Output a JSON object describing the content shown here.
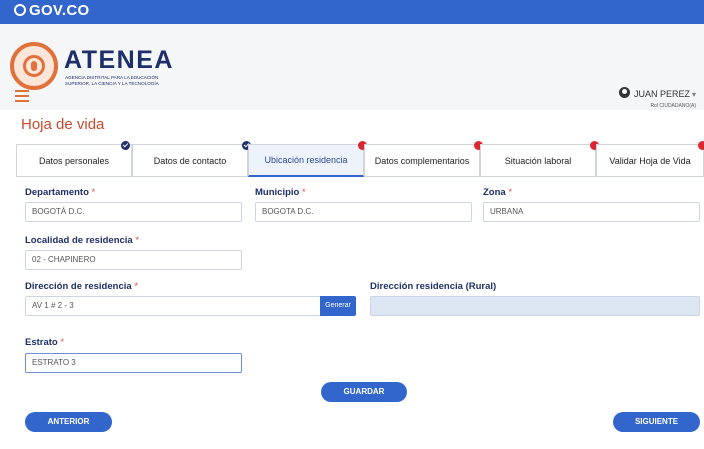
{
  "gov_bar": {
    "label": "GOV.CO",
    "icon": "gov-shield-icon"
  },
  "brand": {
    "name": "ATENEA",
    "subtitle": "AGENCIA DISTRITAL PARA LA EDUCACIÓN SUPERIOR, LA CIENCIA Y LA TECNOLOGÍA",
    "accent": "#e0713a",
    "primary": "#1e2f6b"
  },
  "user": {
    "name": "JUAN PEREZ",
    "role": "Rol CIUDADANO(A)"
  },
  "page_title": "Hoja de vida",
  "tabs": [
    {
      "label": "Datos personales",
      "status": "complete"
    },
    {
      "label": "Datos de contacto",
      "status": "complete"
    },
    {
      "label": "Ubicación residencia",
      "status": "pending",
      "active": true
    },
    {
      "label": "Datos complementarios",
      "status": "pending"
    },
    {
      "label": "Situación laboral",
      "status": "pending"
    },
    {
      "label": "Validar Hoja de Vida",
      "status": "pending"
    }
  ],
  "form": {
    "departamento": {
      "label": "Departamento",
      "required": "*",
      "value": "BOGOTÁ D.C."
    },
    "municipio": {
      "label": "Municipio",
      "required": "*",
      "value": "BOGOTA D.C."
    },
    "zona": {
      "label": "Zona",
      "required": "*",
      "value": "URBANA"
    },
    "localidad": {
      "label": "Localidad de residencia",
      "required": "*",
      "value": "02 - CHAPINERO"
    },
    "direccion": {
      "label": "Dirección de residencia",
      "required": "*",
      "value": "AV 1 # 2 - 3",
      "generate_label": "Generar"
    },
    "direccion_rural": {
      "label": "Dirección residencia (Rural)",
      "value": ""
    },
    "estrato": {
      "label": "Estrato",
      "required": "*",
      "value": "ESTRATO 3"
    }
  },
  "buttons": {
    "save": "GUARDAR",
    "previous": "ANTERIOR",
    "next": "SIGUIENTE"
  },
  "colors": {
    "button_blue": "#3366cc",
    "title_red": "#c84a2c",
    "pending": "#d9262f"
  }
}
